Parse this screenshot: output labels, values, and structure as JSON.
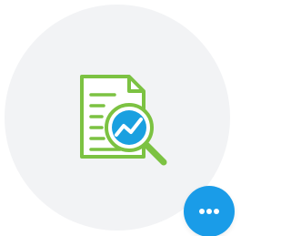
{
  "illustration": {
    "icon": "document-analysis-icon",
    "colors": {
      "outline": "#7cc242",
      "lens_fill": "#19a0e0",
      "trend_line": "#ffffff"
    }
  },
  "background": {
    "color": "#f2f3f5"
  },
  "more_button": {
    "icon": "more-horizontal-icon",
    "color": "#1a9ce8"
  }
}
